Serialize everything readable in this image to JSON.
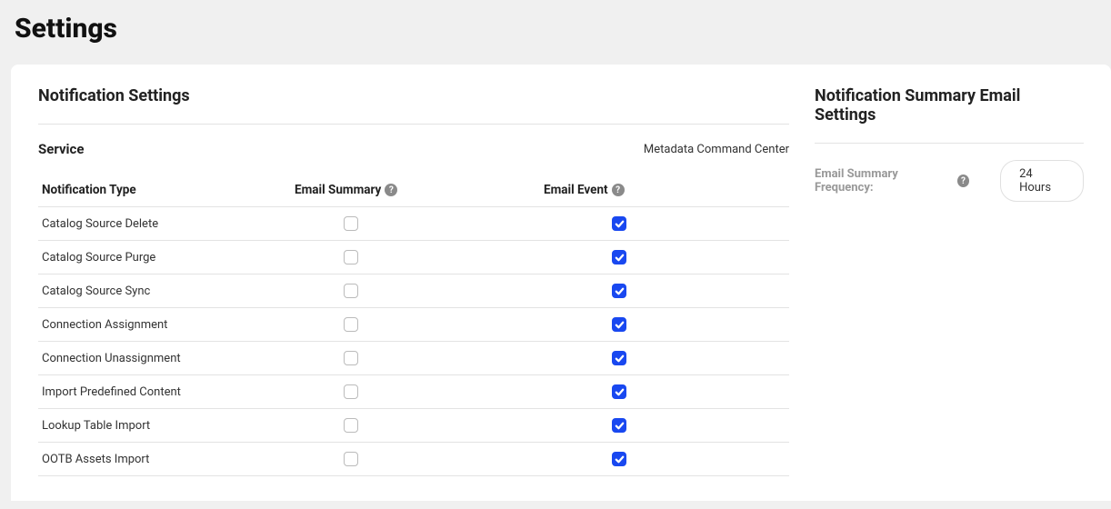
{
  "page_title": "Settings",
  "left": {
    "section_title": "Notification Settings",
    "service_label": "Service",
    "service_value": "Metadata Command Center",
    "headers": {
      "type": "Notification Type",
      "summary": "Email Summary",
      "event": "Email Event"
    },
    "rows": [
      {
        "name": "Catalog Source Delete",
        "summary": false,
        "event": true
      },
      {
        "name": "Catalog Source Purge",
        "summary": false,
        "event": true
      },
      {
        "name": "Catalog Source Sync",
        "summary": false,
        "event": true
      },
      {
        "name": "Connection Assignment",
        "summary": false,
        "event": true
      },
      {
        "name": "Connection Unassignment",
        "summary": false,
        "event": true
      },
      {
        "name": "Import Predefined Content",
        "summary": false,
        "event": true
      },
      {
        "name": "Lookup Table Import",
        "summary": false,
        "event": true
      },
      {
        "name": "OOTB Assets Import",
        "summary": false,
        "event": true
      }
    ]
  },
  "right": {
    "section_title": "Notification Summary Email Settings",
    "freq_label": "Email Summary Frequency:",
    "freq_value": "24 Hours"
  }
}
